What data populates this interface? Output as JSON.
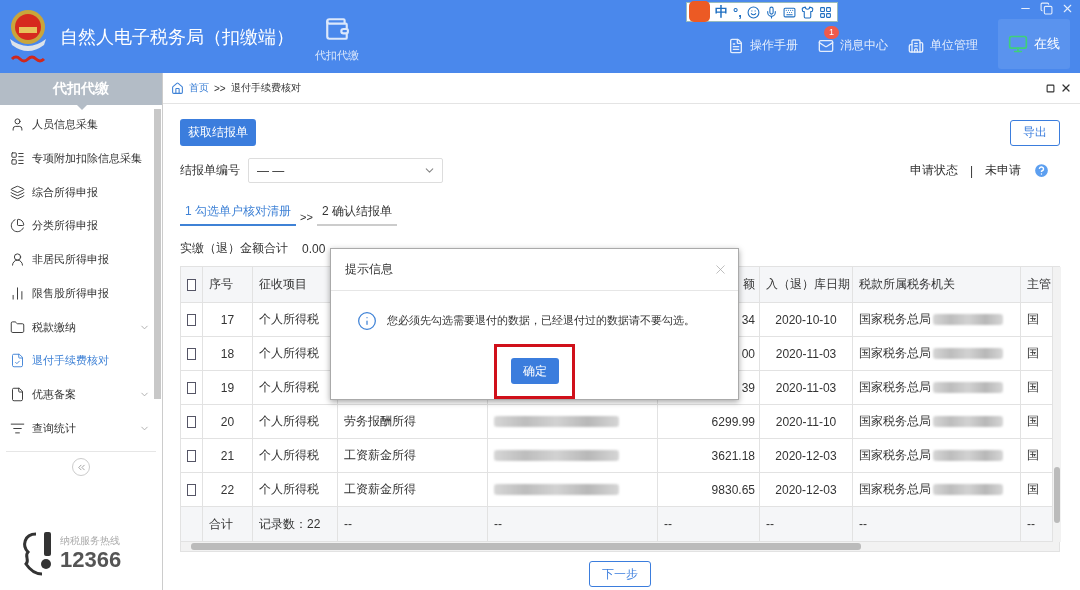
{
  "window": {
    "title": "自然人电子税务局（扣缴端）"
  },
  "ime_toolbar": {
    "mode": "中",
    "punctuation": "°,"
  },
  "header": {
    "nav_tab": {
      "label": "代扣代缴"
    },
    "links": [
      {
        "label": "操作手册"
      },
      {
        "label": "消息中心",
        "badge": "1"
      },
      {
        "label": "单位管理"
      }
    ],
    "status": {
      "label": "在线"
    }
  },
  "sidebar": {
    "title": "代扣代缴",
    "items": [
      {
        "label": "人员信息采集",
        "selected": false,
        "expandable": false
      },
      {
        "label": "专项附加扣除信息采集",
        "selected": false,
        "expandable": false
      },
      {
        "label": "综合所得申报",
        "selected": false,
        "expandable": false
      },
      {
        "label": "分类所得申报",
        "selected": false,
        "expandable": false
      },
      {
        "label": "非居民所得申报",
        "selected": false,
        "expandable": false
      },
      {
        "label": "限售股所得申报",
        "selected": false,
        "expandable": false
      },
      {
        "label": "税款缴纳",
        "selected": false,
        "expandable": true
      },
      {
        "label": "退付手续费核对",
        "selected": true,
        "expandable": false
      },
      {
        "label": "优惠备案",
        "selected": false,
        "expandable": true
      },
      {
        "label": "查询统计",
        "selected": false,
        "expandable": true
      }
    ],
    "hotline": {
      "label": "纳税服务热线",
      "number": "12366"
    }
  },
  "breadcrumb": {
    "home": "首页",
    "separator": ">>",
    "current": "退付手续费核对"
  },
  "toolbar": {
    "fetch_button": "获取结报单",
    "export_button": "导出",
    "select_label": "结报单编号",
    "select_value": "— —",
    "status_label": "申请状态",
    "status_separator": "|",
    "status_value": "未申请"
  },
  "steps": [
    {
      "label": "1 勾选单户核对清册",
      "selected": true
    },
    {
      "label": "2 确认结报单",
      "selected": false
    }
  ],
  "step_separator": ">>",
  "total": {
    "label": "实缴（退）金额合计",
    "value": "0.00"
  },
  "table": {
    "header_checked": false,
    "columns": [
      {
        "kind": "text",
        "label": "序号"
      },
      {
        "kind": "text",
        "label": "征收项目"
      },
      {
        "kind": "covered"
      },
      {
        "kind": "covered"
      },
      {
        "kind": "text",
        "label": "额"
      },
      {
        "kind": "text",
        "label": "入（退）库日期"
      },
      {
        "kind": "text",
        "label": "税款所属税务机关"
      },
      {
        "kind": "text",
        "label": "主管"
      }
    ],
    "rows": [
      {
        "checked": false,
        "cells": [
          {
            "kind": "text",
            "text": "17"
          },
          {
            "kind": "text",
            "text": "个人所得税"
          },
          {
            "kind": "covered"
          },
          {
            "kind": "covered"
          },
          {
            "kind": "text",
            "text": "34"
          },
          {
            "kind": "text",
            "text": "2020-10-10"
          },
          {
            "kind": "text_blurred",
            "text": "国家税务总局"
          },
          {
            "kind": "text",
            "text": "国"
          }
        ]
      },
      {
        "checked": false,
        "cells": [
          {
            "kind": "text",
            "text": "18"
          },
          {
            "kind": "text",
            "text": "个人所得税"
          },
          {
            "kind": "covered"
          },
          {
            "kind": "covered"
          },
          {
            "kind": "text",
            "text": "00"
          },
          {
            "kind": "text",
            "text": "2020-11-03"
          },
          {
            "kind": "text_blurred",
            "text": "国家税务总局"
          },
          {
            "kind": "text",
            "text": "国"
          }
        ]
      },
      {
        "checked": false,
        "cells": [
          {
            "kind": "text",
            "text": "19"
          },
          {
            "kind": "text",
            "text": "个人所得税"
          },
          {
            "kind": "covered"
          },
          {
            "kind": "covered"
          },
          {
            "kind": "text",
            "text": "39"
          },
          {
            "kind": "text",
            "text": "2020-11-03"
          },
          {
            "kind": "text_blurred",
            "text": "国家税务总局"
          },
          {
            "kind": "text",
            "text": "国"
          }
        ]
      },
      {
        "checked": false,
        "cells": [
          {
            "kind": "text",
            "text": "20"
          },
          {
            "kind": "text",
            "text": "个人所得税"
          },
          {
            "kind": "text",
            "text": "劳务报酬所得"
          },
          {
            "kind": "blurred"
          },
          {
            "kind": "text",
            "text": "6299.99"
          },
          {
            "kind": "text",
            "text": "2020-11-10"
          },
          {
            "kind": "text_blurred",
            "text": "国家税务总局"
          },
          {
            "kind": "text",
            "text": "国"
          }
        ]
      },
      {
        "checked": false,
        "cells": [
          {
            "kind": "text",
            "text": "21"
          },
          {
            "kind": "text",
            "text": "个人所得税"
          },
          {
            "kind": "text",
            "text": "工资薪金所得"
          },
          {
            "kind": "blurred"
          },
          {
            "kind": "text",
            "text": "3621.18"
          },
          {
            "kind": "text",
            "text": "2020-12-03"
          },
          {
            "kind": "text_blurred",
            "text": "国家税务总局"
          },
          {
            "kind": "text",
            "text": "国"
          }
        ]
      },
      {
        "checked": false,
        "cells": [
          {
            "kind": "text",
            "text": "22"
          },
          {
            "kind": "text",
            "text": "个人所得税"
          },
          {
            "kind": "text",
            "text": "工资薪金所得"
          },
          {
            "kind": "blurred"
          },
          {
            "kind": "text",
            "text": "9830.65"
          },
          {
            "kind": "text",
            "text": "2020-12-03"
          },
          {
            "kind": "text_blurred",
            "text": "国家税务总局"
          },
          {
            "kind": "text",
            "text": "国"
          }
        ]
      }
    ],
    "footer": [
      "合计",
      "记录数：22",
      "--",
      "--",
      "--",
      "--",
      "--",
      "--"
    ]
  },
  "next_button": "下一步",
  "dialog": {
    "title": "提示信息",
    "message": "您必须先勾选需要退付的数据，已经退付过的数据请不要勾选。",
    "confirm_button": "确定",
    "highlighted": true
  }
}
